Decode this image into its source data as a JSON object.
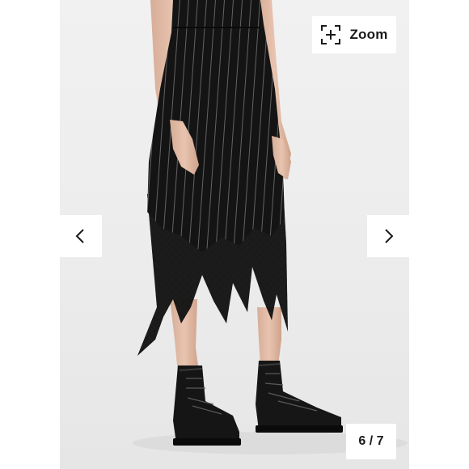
{
  "toolbar": {
    "zoom_label": "Zoom",
    "zoom_icon": "expand-corners-icon"
  },
  "navigation": {
    "prev_icon": "chevron-left-icon",
    "next_icon": "chevron-right-icon"
  },
  "gallery": {
    "counter": "6 / 7"
  }
}
